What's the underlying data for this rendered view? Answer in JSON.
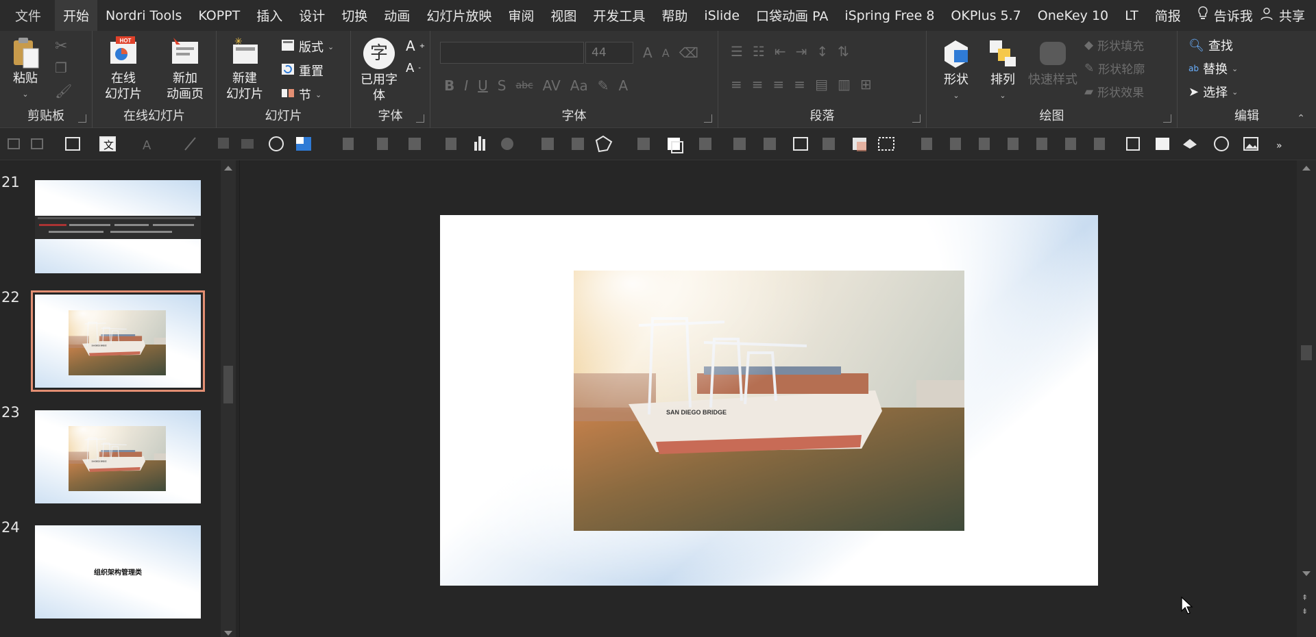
{
  "tabs": [
    "文件",
    "开始",
    "Nordri Tools",
    "KOPPT",
    "插入",
    "设计",
    "切换",
    "动画",
    "幻灯片放映",
    "审阅",
    "视图",
    "开发工具",
    "帮助",
    "iSlide",
    "口袋动画 PA",
    "iSpring Free 8",
    "OKPlus 5.7",
    "OneKey 10",
    "LT",
    "简报"
  ],
  "tell_me": "告诉我",
  "share": "共享",
  "ribbon": {
    "clipboard": {
      "paste": "粘贴",
      "label": "剪贴板"
    },
    "online": {
      "online_slides": "在线\n幻灯片",
      "new_anim": "新加\n动画页",
      "hot": "HOT",
      "label": "在线幻灯片"
    },
    "slides": {
      "new_slide": "新建\n幻灯片",
      "layout": "版式",
      "reset": "重置",
      "section": "节",
      "label": "幻灯片"
    },
    "fontgroup": {
      "used_fonts": "已用字\n体",
      "glyph": "字",
      "label": "字体"
    },
    "font": {
      "font_name": "",
      "font_size": "44",
      "label": "字体"
    },
    "paragraph": {
      "label": "段落"
    },
    "drawing": {
      "shape": "形状",
      "arrange": "排列",
      "quick_style": "快速样式",
      "fill": "形状填充",
      "outline": "形状轮廓",
      "effect": "形状效果",
      "label": "绘图"
    },
    "editing": {
      "find": "查找",
      "replace": "替换",
      "select": "选择",
      "label": "编辑"
    }
  },
  "thumbnails": [
    {
      "num": "21",
      "kind": "ribbon",
      "selected": false
    },
    {
      "num": "22",
      "kind": "photo",
      "selected": true
    },
    {
      "num": "23",
      "kind": "photo",
      "selected": false
    },
    {
      "num": "24",
      "kind": "text",
      "text": "组织架构管理类",
      "selected": false
    }
  ],
  "photo": {
    "ship_name": "SAN DIEGO BRIDGE"
  },
  "colors": {
    "selection": "#e38f73",
    "ribbon_bg": "#333333",
    "tab_bg": "#2b2b2b",
    "canvas_bg": "#262626"
  }
}
